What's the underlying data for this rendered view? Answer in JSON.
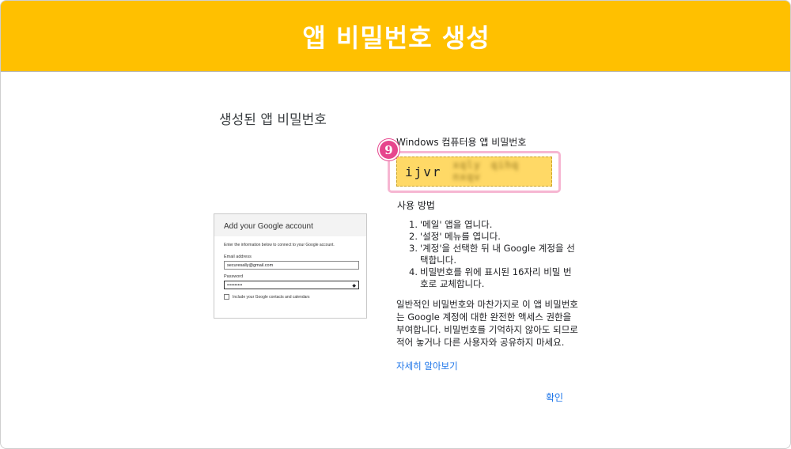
{
  "banner": {
    "title": "앱 비밀번호 생성"
  },
  "section": {
    "title": "생성된 앱 비밀번호"
  },
  "google_dialog": {
    "title": "Add your Google account",
    "info": "Enter the information below to connect to your Google account.",
    "email_label": "Email address",
    "email_value": "securesally@gmail.com",
    "password_label": "Password",
    "password_value": "••••••••••",
    "reveal_icon": "eye-icon",
    "checkbox_label": "Include your Google contacts and calendars"
  },
  "app_password": {
    "label": "Windows 컴퓨터용 앱 비밀번호",
    "visible_part": "ijvr",
    "masked_part": "xqly qihq nxqv",
    "step_number": "9"
  },
  "usage": {
    "title": "사용 방법",
    "steps": [
      {
        "num": "1.",
        "text": "'메일' 앱을 엽니다."
      },
      {
        "num": "2.",
        "text": "'설정' 메뉴를 엽니다."
      },
      {
        "num": "3.",
        "text": "'계정'을 선택한 뒤 내 Google 계정을 선택합니다."
      },
      {
        "num": "4.",
        "text": "비밀번호를 위에 표시된 16자리 비밀 번호로 교체합니다."
      }
    ]
  },
  "note": "일반적인 비밀번호와 마찬가지로 이 앱 비밀번호는 Google 계정에 대한 완전한 액세스 권한을 부여합니다. 비밀번호를 기억하지 않아도 되므로 적어 놓거나 다른 사용자와 공유하지 마세요.",
  "learn_more": "자세히 알아보기",
  "confirm": "확인",
  "colors": {
    "banner": "#ffc000",
    "highlight": "#f6b6d2",
    "badge": "#e6458d",
    "link": "#1a73e8",
    "password_box": "#ffd966"
  }
}
